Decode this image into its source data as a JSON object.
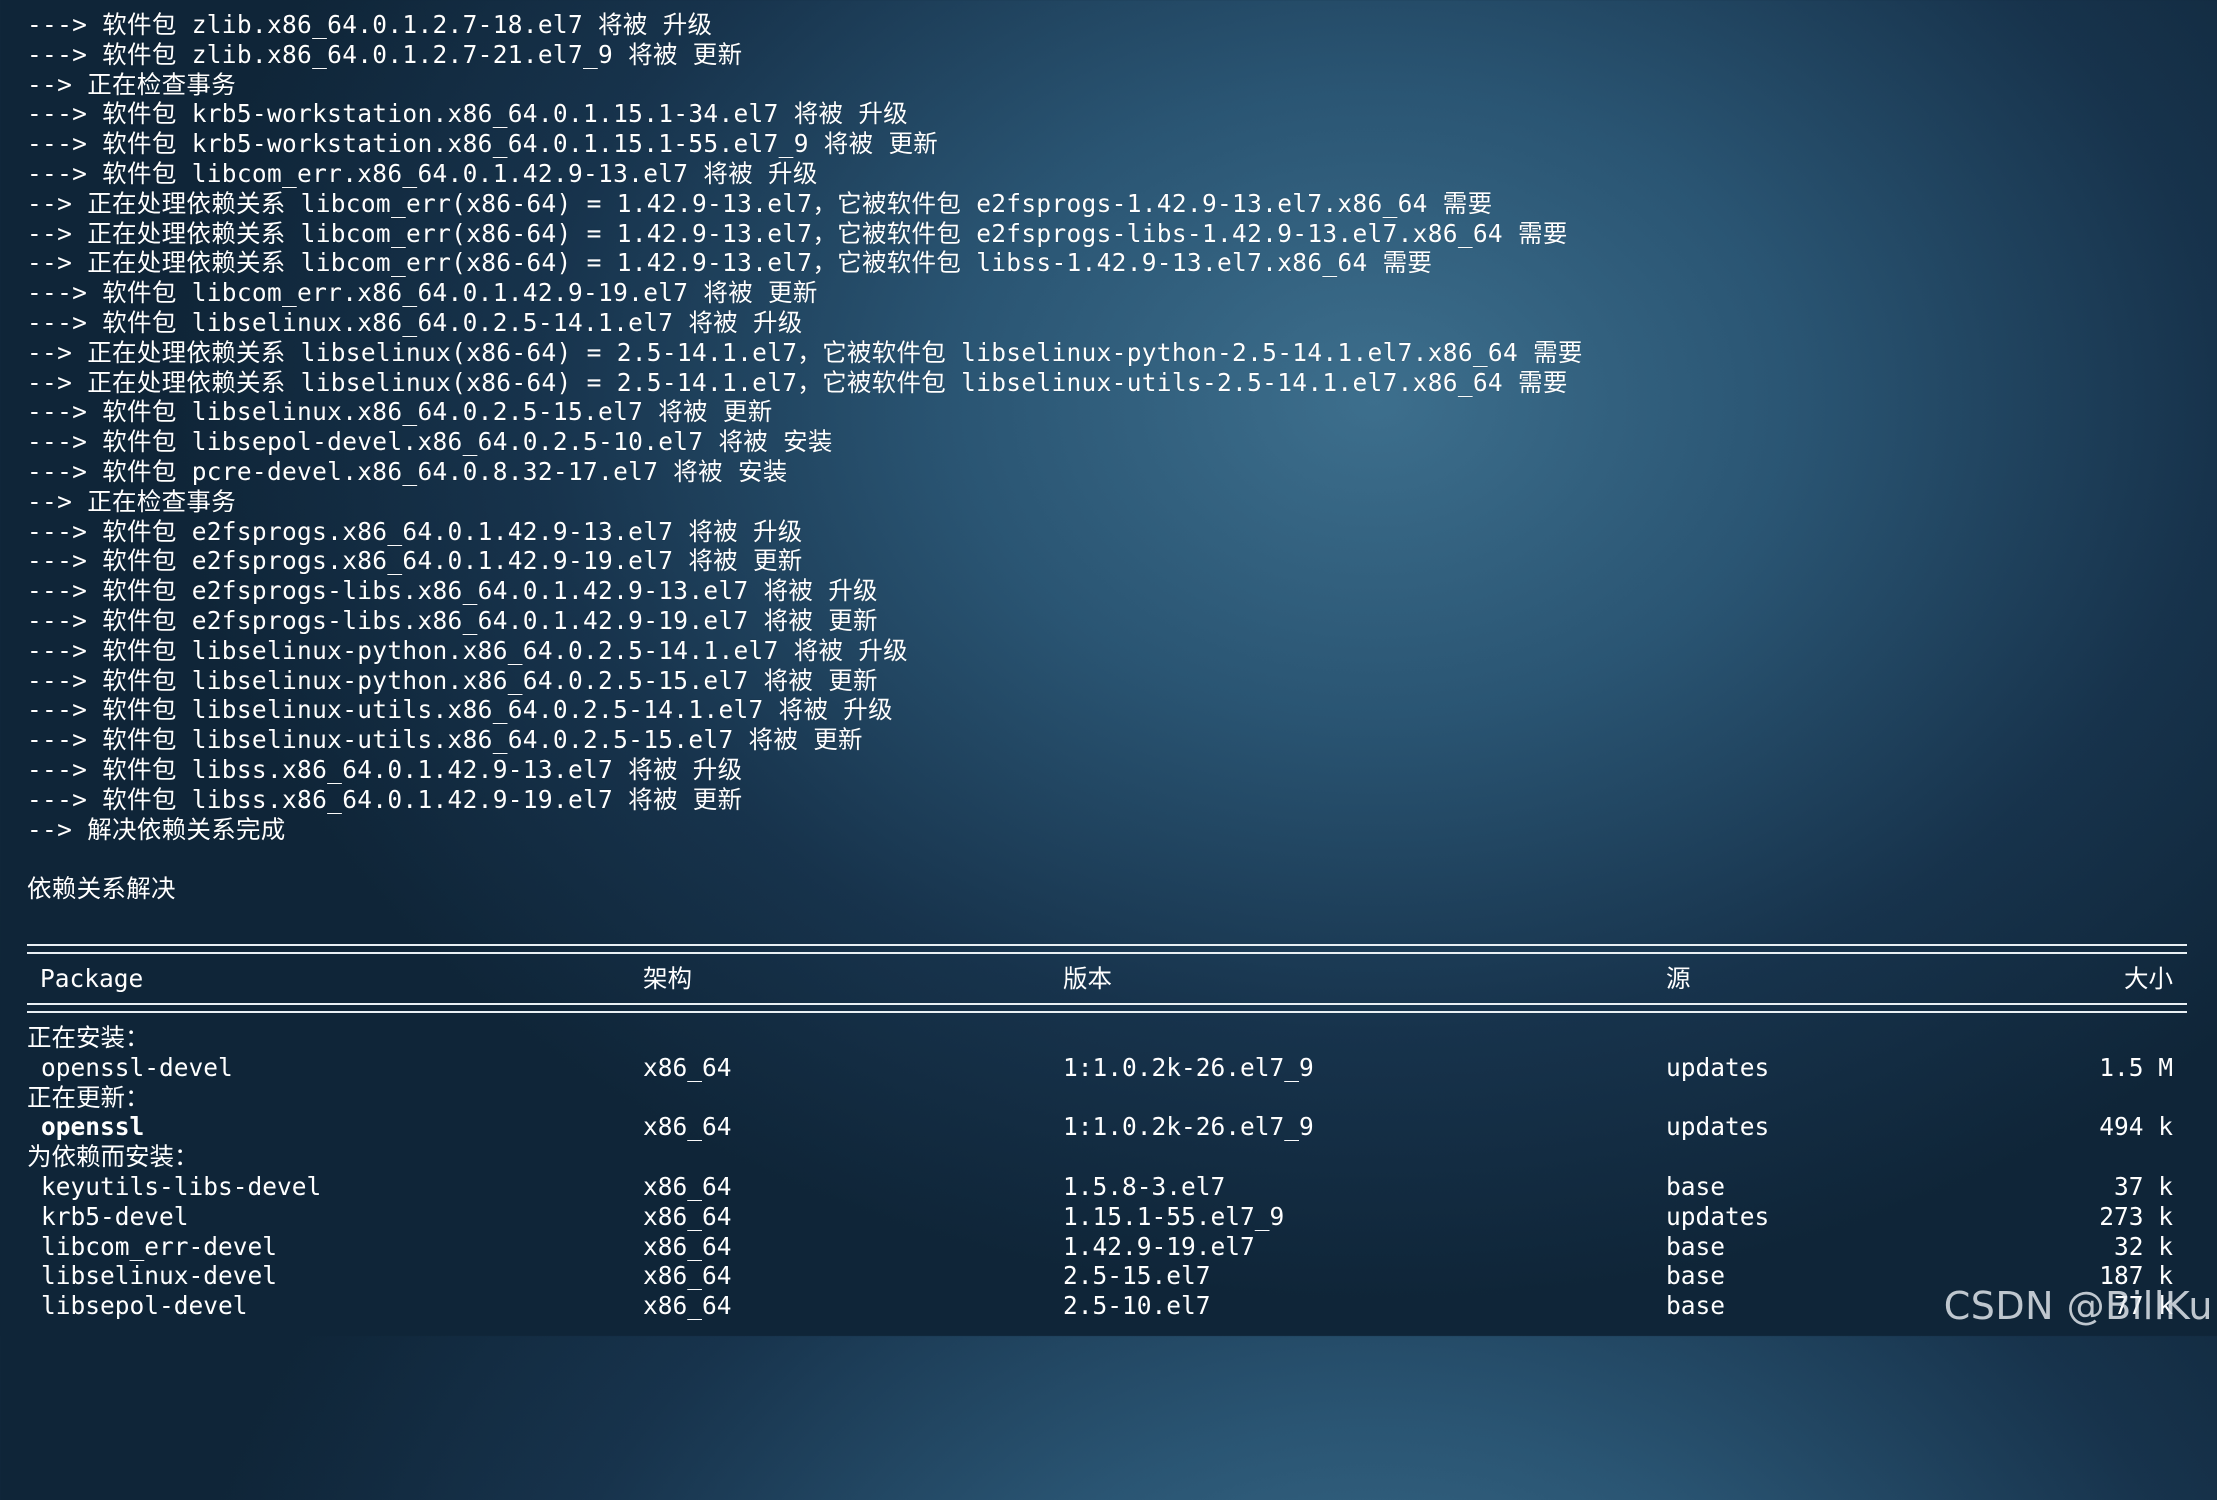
{
  "log_lines": [
    "---> 软件包 zlib.x86_64.0.1.2.7-18.el7 将被 升级",
    "---> 软件包 zlib.x86_64.0.1.2.7-21.el7_9 将被 更新",
    "--> 正在检查事务",
    "---> 软件包 krb5-workstation.x86_64.0.1.15.1-34.el7 将被 升级",
    "---> 软件包 krb5-workstation.x86_64.0.1.15.1-55.el7_9 将被 更新",
    "---> 软件包 libcom_err.x86_64.0.1.42.9-13.el7 将被 升级",
    "--> 正在处理依赖关系 libcom_err(x86-64) = 1.42.9-13.el7，它被软件包 e2fsprogs-1.42.9-13.el7.x86_64 需要",
    "--> 正在处理依赖关系 libcom_err(x86-64) = 1.42.9-13.el7，它被软件包 e2fsprogs-libs-1.42.9-13.el7.x86_64 需要",
    "--> 正在处理依赖关系 libcom_err(x86-64) = 1.42.9-13.el7，它被软件包 libss-1.42.9-13.el7.x86_64 需要",
    "---> 软件包 libcom_err.x86_64.0.1.42.9-19.el7 将被 更新",
    "---> 软件包 libselinux.x86_64.0.2.5-14.1.el7 将被 升级",
    "--> 正在处理依赖关系 libselinux(x86-64) = 2.5-14.1.el7，它被软件包 libselinux-python-2.5-14.1.el7.x86_64 需要",
    "--> 正在处理依赖关系 libselinux(x86-64) = 2.5-14.1.el7，它被软件包 libselinux-utils-2.5-14.1.el7.x86_64 需要",
    "---> 软件包 libselinux.x86_64.0.2.5-15.el7 将被 更新",
    "---> 软件包 libsepol-devel.x86_64.0.2.5-10.el7 将被 安装",
    "---> 软件包 pcre-devel.x86_64.0.8.32-17.el7 将被 安装",
    "--> 正在检查事务",
    "---> 软件包 e2fsprogs.x86_64.0.1.42.9-13.el7 将被 升级",
    "---> 软件包 e2fsprogs.x86_64.0.1.42.9-19.el7 将被 更新",
    "---> 软件包 e2fsprogs-libs.x86_64.0.1.42.9-13.el7 将被 升级",
    "---> 软件包 e2fsprogs-libs.x86_64.0.1.42.9-19.el7 将被 更新",
    "---> 软件包 libselinux-python.x86_64.0.2.5-14.1.el7 将被 升级",
    "---> 软件包 libselinux-python.x86_64.0.2.5-15.el7 将被 更新",
    "---> 软件包 libselinux-utils.x86_64.0.2.5-14.1.el7 将被 升级",
    "---> 软件包 libselinux-utils.x86_64.0.2.5-15.el7 将被 更新",
    "---> 软件包 libss.x86_64.0.1.42.9-13.el7 将被 升级",
    "---> 软件包 libss.x86_64.0.1.42.9-19.el7 将被 更新",
    "--> 解决依赖关系完成"
  ],
  "resolved_label": "依赖关系解决",
  "table": {
    "headers": {
      "package": "Package",
      "arch": "架构",
      "version": "版本",
      "repo": "源",
      "size": "大小"
    },
    "groups": {
      "installing": {
        "title": "正在安装：",
        "rows": [
          {
            "package": "openssl-devel",
            "arch": "x86_64",
            "version": "1:1.0.2k-26.el7_9",
            "repo": "updates",
            "size": "1.5 M"
          }
        ]
      },
      "updating": {
        "title": "正在更新：",
        "rows": [
          {
            "package": "openssl",
            "arch": "x86_64",
            "version": "1:1.0.2k-26.el7_9",
            "repo": "updates",
            "size": "494 k"
          }
        ]
      },
      "deps": {
        "title": "为依赖而安装：",
        "rows": [
          {
            "package": "keyutils-libs-devel",
            "arch": "x86_64",
            "version": "1.5.8-3.el7",
            "repo": "base",
            "size": "37 k"
          },
          {
            "package": "krb5-devel",
            "arch": "x86_64",
            "version": "1.15.1-55.el7_9",
            "repo": "updates",
            "size": "273 k"
          },
          {
            "package": "libcom_err-devel",
            "arch": "x86_64",
            "version": "1.42.9-19.el7",
            "repo": "base",
            "size": "32 k"
          },
          {
            "package": "libselinux-devel",
            "arch": "x86_64",
            "version": "2.5-15.el7",
            "repo": "base",
            "size": "187 k"
          },
          {
            "package": "libsepol-devel",
            "arch": "x86_64",
            "version": "2.5-10.el7",
            "repo": "base",
            "size": "77 k"
          }
        ]
      }
    }
  },
  "watermark": "CSDN @BillKu"
}
